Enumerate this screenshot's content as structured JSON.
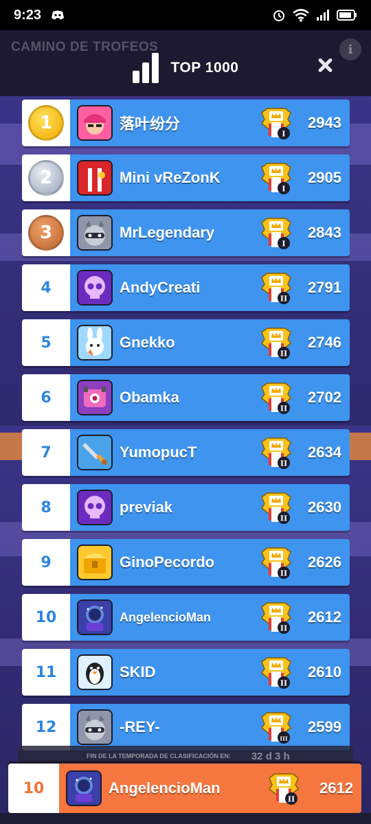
{
  "status_bar": {
    "time": "9:23"
  },
  "screen": {
    "subtitle": "CAMINO DE TROFEOS",
    "title": "TOP 1000",
    "info_glyph": "i"
  },
  "season": {
    "label": "FIN DE LA TEMPORADA DE CLASIFICACIÓN EN:",
    "time_left": "32 d 3 h"
  },
  "leaderboard": [
    {
      "rank": "1",
      "name": "落叶纷分",
      "trophies": "2943",
      "league_tier": "I",
      "avatar": "pink-hair-brawler-icon"
    },
    {
      "rank": "2",
      "name": "Mini vReZonK",
      "trophies": "2905",
      "league_tier": "I",
      "avatar": "red-jacket-icon"
    },
    {
      "rank": "3",
      "name": "MrLegendary",
      "trophies": "2843",
      "league_tier": "I",
      "avatar": "raccoon-icon"
    },
    {
      "rank": "4",
      "name": "AndyCreati",
      "trophies": "2791",
      "league_tier": "II",
      "avatar": "purple-skull-icon"
    },
    {
      "rank": "5",
      "name": "Gnekko",
      "trophies": "2746",
      "league_tier": "II",
      "avatar": "bunny-icon"
    },
    {
      "rank": "6",
      "name": "Obamka",
      "trophies": "2702",
      "league_tier": "II",
      "avatar": "pink-robot-icon"
    },
    {
      "rank": "7",
      "name": "YumopucT",
      "trophies": "2634",
      "league_tier": "II",
      "avatar": "sword-icon"
    },
    {
      "rank": "8",
      "name": "previak",
      "trophies": "2630",
      "league_tier": "II",
      "avatar": "purple-skull-icon"
    },
    {
      "rank": "9",
      "name": "GinoPecordo",
      "trophies": "2626",
      "league_tier": "II",
      "avatar": "treasure-chest-icon"
    },
    {
      "rank": "10",
      "name": "AngelencioMan",
      "trophies": "2612",
      "league_tier": "II",
      "avatar": "wizard-icon"
    },
    {
      "rank": "11",
      "name": "SKID",
      "trophies": "2610",
      "league_tier": "II",
      "avatar": "penguin-icon"
    },
    {
      "rank": "12",
      "name": "-REY-",
      "trophies": "2599",
      "league_tier": "III",
      "avatar": "raccoon-icon"
    }
  ],
  "current_player": {
    "rank": "10",
    "name": "AngelencioMan",
    "trophies": "2612",
    "league_tier": "II",
    "avatar": "wizard-icon"
  },
  "colors": {
    "row_blue": "#3e94ee",
    "rank_text": "#2e86de",
    "current_orange": "#f5763e",
    "gold": "#f2a900",
    "silver": "#98a6b8",
    "bronze": "#b8642f"
  }
}
